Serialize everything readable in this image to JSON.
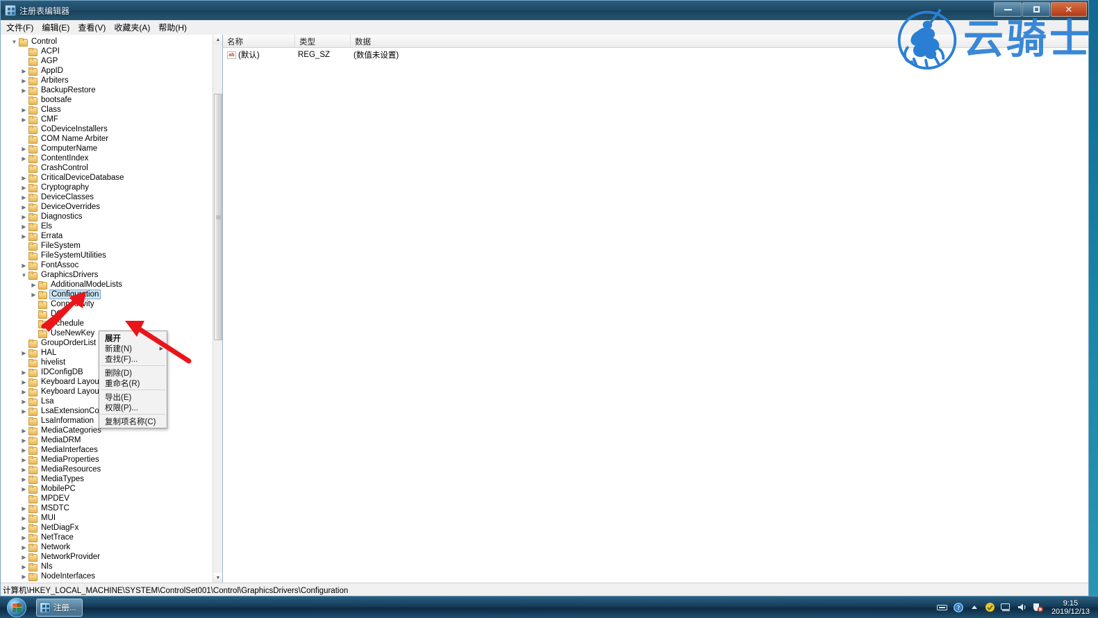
{
  "window": {
    "title": "注册表编辑器",
    "icon": "registry-editor-icon",
    "controls": {
      "minimize": "最小化",
      "maximize": "最大化",
      "close": "关闭"
    }
  },
  "menubar": {
    "items": [
      {
        "label": "文件(F)",
        "name": "menu-file"
      },
      {
        "label": "编辑(E)",
        "name": "menu-edit"
      },
      {
        "label": "查看(V)",
        "name": "menu-view"
      },
      {
        "label": "收藏夹(A)",
        "name": "menu-favorites"
      },
      {
        "label": "帮助(H)",
        "name": "menu-help"
      }
    ]
  },
  "tree": {
    "items": [
      {
        "label": "Control",
        "depth": 0,
        "expander": "down",
        "selected": false
      },
      {
        "label": "ACPI",
        "depth": 1,
        "expander": "none",
        "selected": false
      },
      {
        "label": "AGP",
        "depth": 1,
        "expander": "none",
        "selected": false
      },
      {
        "label": "AppID",
        "depth": 1,
        "expander": "right",
        "selected": false
      },
      {
        "label": "Arbiters",
        "depth": 1,
        "expander": "right",
        "selected": false
      },
      {
        "label": "BackupRestore",
        "depth": 1,
        "expander": "right",
        "selected": false
      },
      {
        "label": "bootsafe",
        "depth": 1,
        "expander": "none",
        "selected": false
      },
      {
        "label": "Class",
        "depth": 1,
        "expander": "right",
        "selected": false
      },
      {
        "label": "CMF",
        "depth": 1,
        "expander": "right",
        "selected": false
      },
      {
        "label": "CoDeviceInstallers",
        "depth": 1,
        "expander": "none",
        "selected": false
      },
      {
        "label": "COM Name Arbiter",
        "depth": 1,
        "expander": "none",
        "selected": false
      },
      {
        "label": "ComputerName",
        "depth": 1,
        "expander": "right",
        "selected": false
      },
      {
        "label": "ContentIndex",
        "depth": 1,
        "expander": "right",
        "selected": false
      },
      {
        "label": "CrashControl",
        "depth": 1,
        "expander": "none",
        "selected": false
      },
      {
        "label": "CriticalDeviceDatabase",
        "depth": 1,
        "expander": "right",
        "selected": false
      },
      {
        "label": "Cryptography",
        "depth": 1,
        "expander": "right",
        "selected": false
      },
      {
        "label": "DeviceClasses",
        "depth": 1,
        "expander": "right",
        "selected": false
      },
      {
        "label": "DeviceOverrides",
        "depth": 1,
        "expander": "right",
        "selected": false
      },
      {
        "label": "Diagnostics",
        "depth": 1,
        "expander": "right",
        "selected": false
      },
      {
        "label": "Els",
        "depth": 1,
        "expander": "right",
        "selected": false
      },
      {
        "label": "Errata",
        "depth": 1,
        "expander": "right",
        "selected": false
      },
      {
        "label": "FileSystem",
        "depth": 1,
        "expander": "none",
        "selected": false
      },
      {
        "label": "FileSystemUtilities",
        "depth": 1,
        "expander": "none",
        "selected": false
      },
      {
        "label": "FontAssoc",
        "depth": 1,
        "expander": "right",
        "selected": false
      },
      {
        "label": "GraphicsDrivers",
        "depth": 1,
        "expander": "down",
        "selected": false
      },
      {
        "label": "AdditionalModeLists",
        "depth": 2,
        "expander": "right",
        "selected": false
      },
      {
        "label": "Configuration",
        "depth": 2,
        "expander": "right",
        "selected": true
      },
      {
        "label": "Connectivity",
        "depth": 2,
        "expander": "none",
        "selected": false
      },
      {
        "label": "DCI",
        "depth": 2,
        "expander": "none",
        "selected": false
      },
      {
        "label": "Schedule",
        "depth": 2,
        "expander": "none",
        "selected": false
      },
      {
        "label": "UseNewKey",
        "depth": 2,
        "expander": "none",
        "selected": false
      },
      {
        "label": "GroupOrderList",
        "depth": 1,
        "expander": "none",
        "selected": false
      },
      {
        "label": "HAL",
        "depth": 1,
        "expander": "right",
        "selected": false
      },
      {
        "label": "hivelist",
        "depth": 1,
        "expander": "none",
        "selected": false
      },
      {
        "label": "IDConfigDB",
        "depth": 1,
        "expander": "right",
        "selected": false
      },
      {
        "label": "Keyboard Layout",
        "depth": 1,
        "expander": "right",
        "selected": false
      },
      {
        "label": "Keyboard Layouts",
        "depth": 1,
        "expander": "right",
        "selected": false
      },
      {
        "label": "Lsa",
        "depth": 1,
        "expander": "right",
        "selected": false
      },
      {
        "label": "LsaExtensionConfig",
        "depth": 1,
        "expander": "right",
        "selected": false
      },
      {
        "label": "LsaInformation",
        "depth": 1,
        "expander": "none",
        "selected": false
      },
      {
        "label": "MediaCategories",
        "depth": 1,
        "expander": "right",
        "selected": false
      },
      {
        "label": "MediaDRM",
        "depth": 1,
        "expander": "right",
        "selected": false
      },
      {
        "label": "MediaInterfaces",
        "depth": 1,
        "expander": "right",
        "selected": false
      },
      {
        "label": "MediaProperties",
        "depth": 1,
        "expander": "right",
        "selected": false
      },
      {
        "label": "MediaResources",
        "depth": 1,
        "expander": "right",
        "selected": false
      },
      {
        "label": "MediaTypes",
        "depth": 1,
        "expander": "right",
        "selected": false
      },
      {
        "label": "MobilePC",
        "depth": 1,
        "expander": "right",
        "selected": false
      },
      {
        "label": "MPDEV",
        "depth": 1,
        "expander": "none",
        "selected": false
      },
      {
        "label": "MSDTC",
        "depth": 1,
        "expander": "right",
        "selected": false
      },
      {
        "label": "MUI",
        "depth": 1,
        "expander": "right",
        "selected": false
      },
      {
        "label": "NetDiagFx",
        "depth": 1,
        "expander": "right",
        "selected": false
      },
      {
        "label": "NetTrace",
        "depth": 1,
        "expander": "right",
        "selected": false
      },
      {
        "label": "Network",
        "depth": 1,
        "expander": "right",
        "selected": false
      },
      {
        "label": "NetworkProvider",
        "depth": 1,
        "expander": "right",
        "selected": false
      },
      {
        "label": "Nls",
        "depth": 1,
        "expander": "right",
        "selected": false
      },
      {
        "label": "NodeInterfaces",
        "depth": 1,
        "expander": "right",
        "selected": false
      }
    ]
  },
  "values": {
    "columns": [
      {
        "label": "名称",
        "name": "col-name"
      },
      {
        "label": "类型",
        "name": "col-type"
      },
      {
        "label": "数据",
        "name": "col-data"
      }
    ],
    "rows": [
      {
        "name": "(默认)",
        "type": "REG_SZ",
        "data": "(数值未设置)",
        "icon": "string-value-icon"
      }
    ]
  },
  "context_menu": {
    "items": [
      {
        "label": "展开",
        "bold": true,
        "separator_after": false,
        "submenu": false
      },
      {
        "label": "新建(N)",
        "bold": false,
        "separator_after": false,
        "submenu": true
      },
      {
        "label": "查找(F)...",
        "bold": false,
        "separator_after": true,
        "submenu": false
      },
      {
        "label": "删除(D)",
        "bold": false,
        "separator_after": false,
        "submenu": false
      },
      {
        "label": "重命名(R)",
        "bold": false,
        "separator_after": true,
        "submenu": false
      },
      {
        "label": "导出(E)",
        "bold": false,
        "separator_after": false,
        "submenu": false
      },
      {
        "label": "权限(P)...",
        "bold": false,
        "separator_after": true,
        "submenu": false
      },
      {
        "label": "复制项名称(C)",
        "bold": false,
        "separator_after": false,
        "submenu": false
      }
    ]
  },
  "statusbar": {
    "path": "计算机\\HKEY_LOCAL_MACHINE\\SYSTEM\\ControlSet001\\Control\\GraphicsDrivers\\Configuration"
  },
  "watermark": {
    "text": "云骑士",
    "logo": "horseman-rider-logo",
    "color": "#2a7fd4"
  },
  "annotations": {
    "arrow_color": "#e8161a",
    "arrows": [
      {
        "name": "arrow-to-configuration",
        "points_to": "Configuration"
      },
      {
        "name": "arrow-to-find-menu-item",
        "points_to": "查找(F)..."
      }
    ]
  },
  "taskbar": {
    "start_label": "开始",
    "tasks": [
      {
        "label": "注册...",
        "icon": "registry-editor-icon",
        "active": true
      }
    ],
    "tray": {
      "icons": [
        "keyboard-icon",
        "help-icon",
        "show-hidden-icon",
        "action-center-icon",
        "network-icon",
        "volume-icon",
        "security-alert-icon"
      ],
      "time": "9:15",
      "date": "2019/12/13"
    }
  }
}
